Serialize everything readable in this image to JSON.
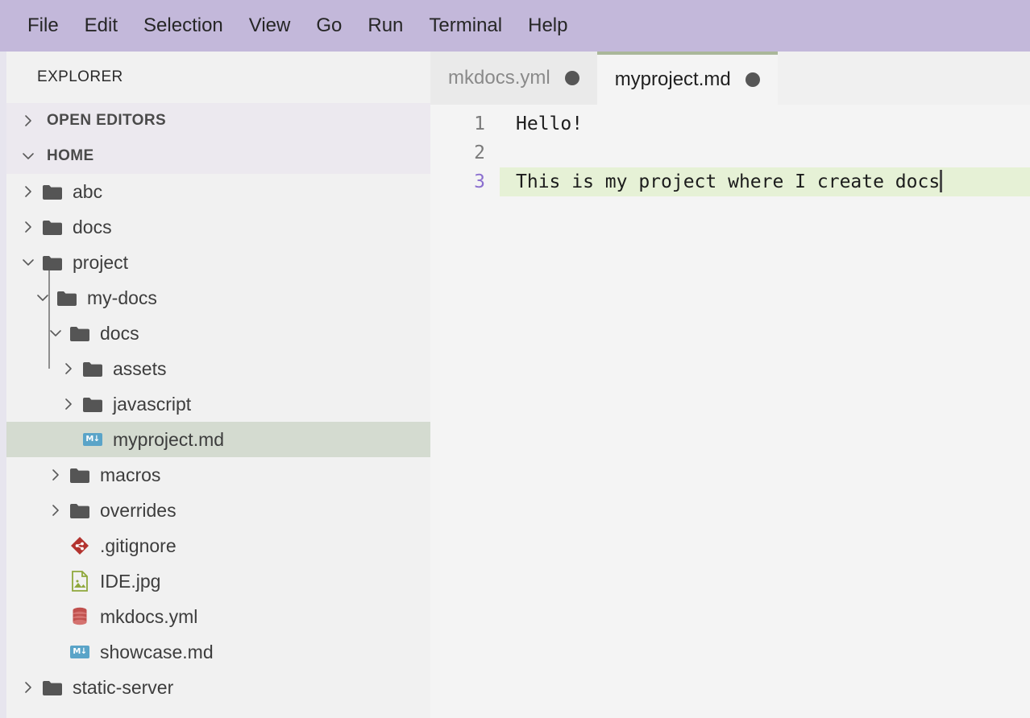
{
  "menubar": {
    "items": [
      {
        "label": "File"
      },
      {
        "label": "Edit"
      },
      {
        "label": "Selection"
      },
      {
        "label": "View"
      },
      {
        "label": "Go"
      },
      {
        "label": "Run"
      },
      {
        "label": "Terminal"
      },
      {
        "label": "Help"
      }
    ],
    "background": "#c3b8da"
  },
  "sidebar": {
    "title": "EXPLORER",
    "sections": [
      {
        "label": "OPEN EDITORS",
        "expanded": false,
        "icon": "chevron-right-icon"
      },
      {
        "label": "HOME",
        "expanded": true,
        "icon": "chevron-down-icon"
      }
    ],
    "tree": [
      {
        "label": "abc",
        "type": "folder",
        "icon": "folder-icon",
        "depth": 0,
        "expanded": false,
        "selected": false
      },
      {
        "label": "docs",
        "type": "folder",
        "icon": "folder-icon",
        "depth": 0,
        "expanded": false,
        "selected": false
      },
      {
        "label": "project",
        "type": "folder",
        "icon": "folder-icon",
        "depth": 0,
        "expanded": true,
        "selected": false
      },
      {
        "label": "my-docs",
        "type": "folder",
        "icon": "folder-icon",
        "depth": 1,
        "expanded": true,
        "selected": false
      },
      {
        "label": "docs",
        "type": "folder",
        "icon": "folder-icon",
        "depth": 2,
        "expanded": true,
        "selected": false
      },
      {
        "label": "assets",
        "type": "folder",
        "icon": "folder-icon",
        "depth": 3,
        "expanded": false,
        "selected": false
      },
      {
        "label": "javascript",
        "type": "folder",
        "icon": "folder-icon",
        "depth": 3,
        "expanded": false,
        "selected": false
      },
      {
        "label": "myproject.md",
        "type": "file",
        "icon": "markdown-file-icon",
        "depth": 3,
        "expanded": null,
        "selected": true
      },
      {
        "label": "macros",
        "type": "folder",
        "icon": "folder-icon",
        "depth": 2,
        "expanded": false,
        "selected": false
      },
      {
        "label": "overrides",
        "type": "folder",
        "icon": "folder-icon",
        "depth": 2,
        "expanded": false,
        "selected": false
      },
      {
        "label": ".gitignore",
        "type": "file",
        "icon": "git-file-icon",
        "depth": 2,
        "expanded": null,
        "selected": false
      },
      {
        "label": "IDE.jpg",
        "type": "file",
        "icon": "image-file-icon",
        "depth": 2,
        "expanded": null,
        "selected": false
      },
      {
        "label": "mkdocs.yml",
        "type": "file",
        "icon": "yaml-database-file-icon",
        "depth": 2,
        "expanded": null,
        "selected": false
      },
      {
        "label": "showcase.md",
        "type": "file",
        "icon": "markdown-file-icon",
        "depth": 2,
        "expanded": null,
        "selected": false
      },
      {
        "label": "static-server",
        "type": "folder",
        "icon": "folder-icon",
        "depth": 0,
        "expanded": false,
        "selected": false
      }
    ],
    "selected_background": "#d4dbd0",
    "background": "#f1f1f1"
  },
  "editor": {
    "tabs": [
      {
        "label": "mkdocs.yml",
        "active": false,
        "dirty": true
      },
      {
        "label": "myproject.md",
        "active": true,
        "dirty": true
      }
    ],
    "active_tab_indicator_color": "#aab79a",
    "lines": [
      {
        "number": "1",
        "text": "Hello!",
        "active": false
      },
      {
        "number": "2",
        "text": "",
        "active": false
      },
      {
        "number": "3",
        "text": "This is my project where I create docs",
        "active": true
      }
    ],
    "active_line_highlight": "#e6f1d6",
    "active_line_number_color": "#8b6fcf",
    "cursor_line": "3",
    "cursor_column": "38"
  },
  "icons": {
    "markdown_badge_text": "M↓"
  }
}
